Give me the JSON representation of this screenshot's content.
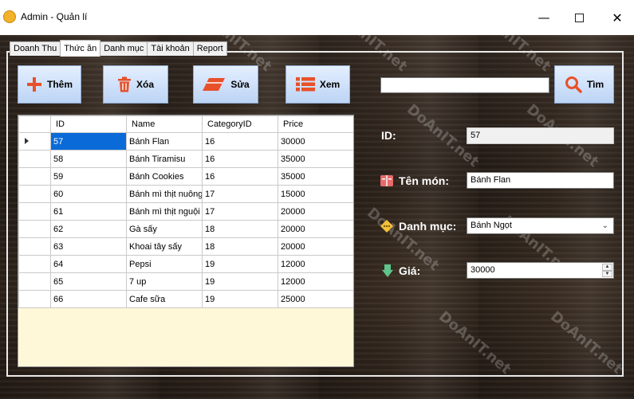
{
  "window": {
    "title": "Admin - Quản lí"
  },
  "tabs": [
    {
      "label": "Doanh Thu"
    },
    {
      "label": "Thức ăn"
    },
    {
      "label": "Danh mục"
    },
    {
      "label": "Tài khoản"
    },
    {
      "label": "Report"
    }
  ],
  "active_tab": "Thức ăn",
  "toolbar": {
    "add_label": "Thêm",
    "delete_label": "Xóa",
    "edit_label": "Sửa",
    "view_label": "Xem",
    "search_label": "Tìm"
  },
  "search": {
    "value": ""
  },
  "grid": {
    "columns": [
      "ID",
      "Name",
      "CategoryID",
      "Price"
    ],
    "rows": [
      {
        "id": "57",
        "name": "Bánh Flan",
        "category": "16",
        "price": "30000"
      },
      {
        "id": "58",
        "name": "Bánh Tiramisu",
        "category": "16",
        "price": "35000"
      },
      {
        "id": "59",
        "name": "Bánh Cookies",
        "category": "16",
        "price": "35000"
      },
      {
        "id": "60",
        "name": "Bánh mì thịt nuông",
        "category": "17",
        "price": "15000"
      },
      {
        "id": "61",
        "name": "Bánh mì thịt nguội",
        "category": "17",
        "price": "20000"
      },
      {
        "id": "62",
        "name": "Gà sấy",
        "category": "18",
        "price": "20000"
      },
      {
        "id": "63",
        "name": "Khoai tây sấy",
        "category": "18",
        "price": "20000"
      },
      {
        "id": "64",
        "name": "Pepsi",
        "category": "19",
        "price": "12000"
      },
      {
        "id": "65",
        "name": "7 up",
        "category": "19",
        "price": "12000"
      },
      {
        "id": "66",
        "name": "Cafe sữa",
        "category": "19",
        "price": "25000"
      }
    ],
    "selected_row": 0
  },
  "form": {
    "id_label": "ID:",
    "id_value": "57",
    "name_label": "Tên món:",
    "name_value": "Bánh Flan",
    "category_label": "Danh mục:",
    "category_value": "Bánh Ngọt",
    "price_label": "Giá:",
    "price_value": "30000"
  },
  "watermark": "DoAnIT.net",
  "colors": {
    "button_top": "#e4efff",
    "button_bottom": "#bcd4f5",
    "selection": "#0a6bd8",
    "grid_empty": "#fff8d8",
    "icon_red": "#e8502a"
  }
}
